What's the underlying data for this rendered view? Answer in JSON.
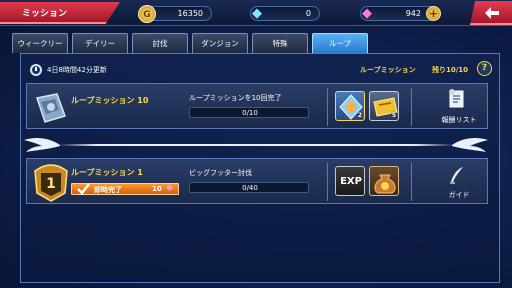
{
  "header": {
    "title": "ミッション",
    "coins": "16350",
    "blue_gems": "0",
    "pink_gems": "942"
  },
  "tabs": [
    {
      "label": "ウィークリー",
      "active": false
    },
    {
      "label": "デイリー",
      "active": false
    },
    {
      "label": "討伐",
      "active": false
    },
    {
      "label": "ダンジョン",
      "active": false
    },
    {
      "label": "特殊",
      "active": false
    },
    {
      "label": "ループ",
      "active": true
    }
  ],
  "info": {
    "update_time": "4日8時間42分更新",
    "loop_label": "ループミッション",
    "loop_remaining": "残り10/10"
  },
  "missions": [
    {
      "name": "ループミッション 10",
      "description": "ループミッションを10回完了",
      "progress": "0/10",
      "rewards": [
        {
          "icon": "crystal-icon",
          "count": "2"
        },
        {
          "icon": "ticket-icon",
          "count": "5"
        }
      ],
      "side_button": "報酬リスト"
    },
    {
      "name": "ループミッション 1",
      "level": "1",
      "immediate_label": "即時完了",
      "immediate_cost": "10",
      "description": "ビッグフッター討伐",
      "progress": "0/40",
      "rewards": [
        {
          "icon": "exp-icon",
          "label": "EXP"
        },
        {
          "icon": "gold-bag-icon",
          "count": ""
        }
      ],
      "side_button": "ガイド"
    }
  ]
}
